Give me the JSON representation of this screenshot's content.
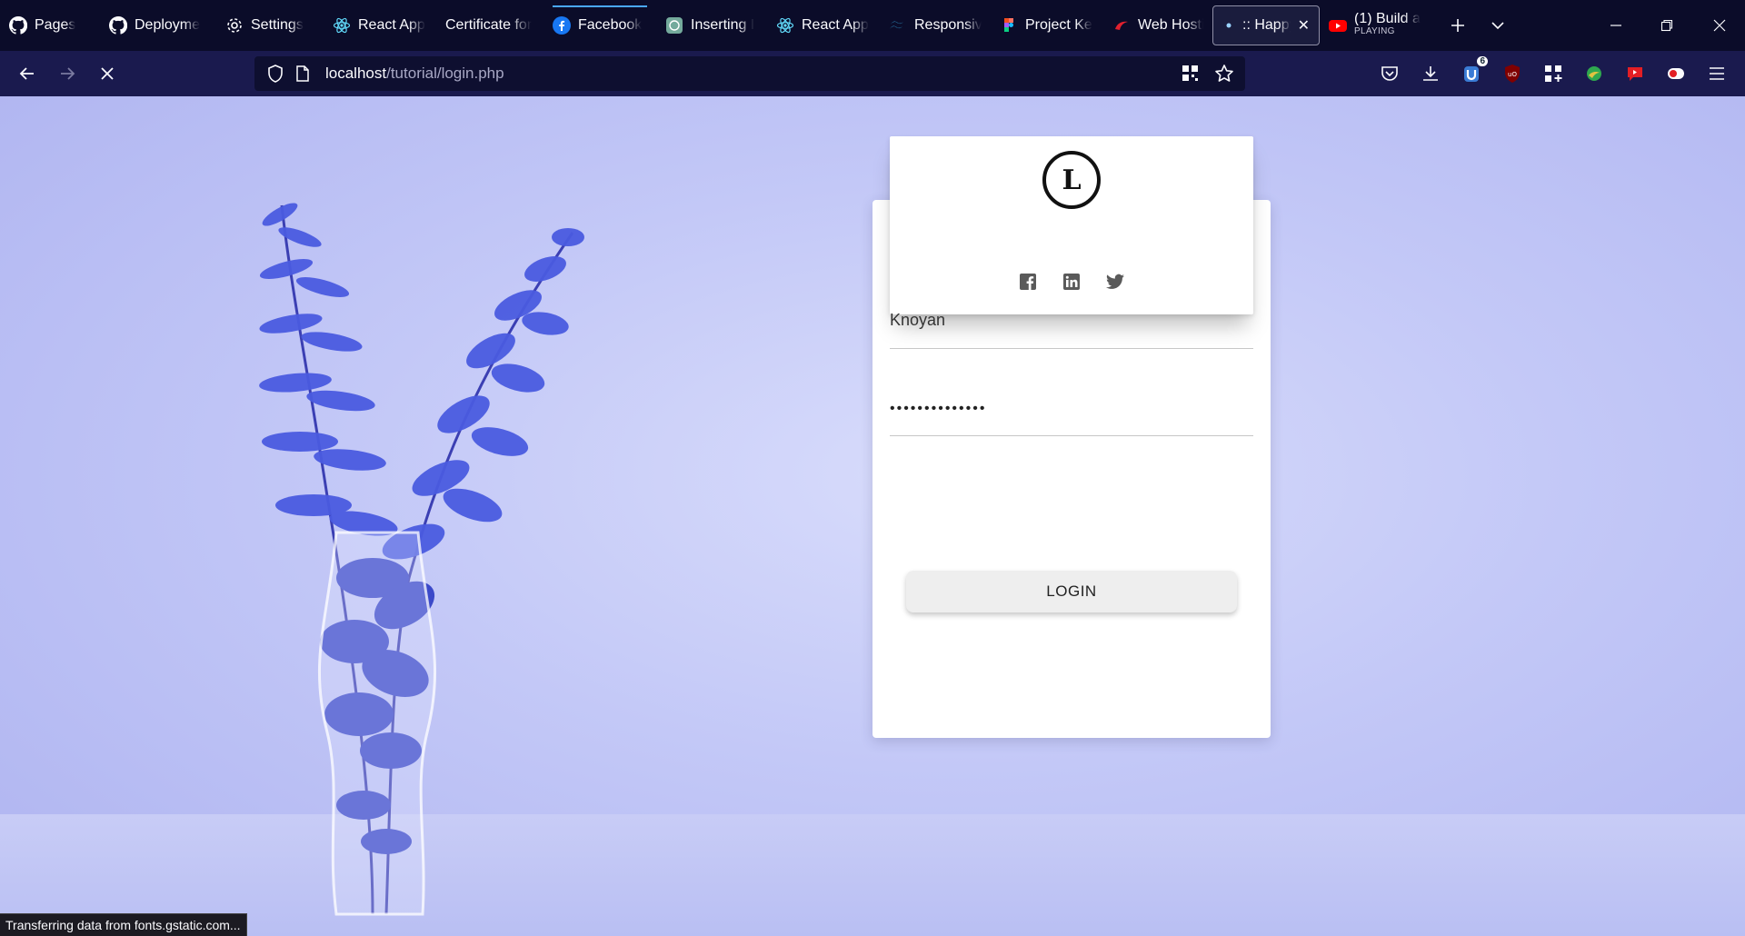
{
  "tabs": [
    {
      "title": "Pages",
      "icon": "github-icon"
    },
    {
      "title": "Deployme",
      "icon": "github-icon"
    },
    {
      "title": "Settings",
      "icon": "gear-icon"
    },
    {
      "title": "React App",
      "icon": "react-icon"
    },
    {
      "title": "Certificate for",
      "icon": "none"
    },
    {
      "title": "Facebook",
      "icon": "facebook-icon"
    },
    {
      "title": "Inserting I",
      "icon": "chatgpt-icon"
    },
    {
      "title": "React App",
      "icon": "react-icon"
    },
    {
      "title": "Responsiv",
      "icon": "tailwind-icon"
    },
    {
      "title": "Project Ke",
      "icon": "figma-icon"
    },
    {
      "title": "Web Hosti",
      "icon": "hosting-icon"
    },
    {
      "title": ":: Happy",
      "icon": "loading-dot-icon",
      "active": true
    },
    {
      "title": "(1) Build a",
      "subtitle": "PLAYING",
      "icon": "youtube-icon"
    }
  ],
  "nav": {
    "url_host": "localhost",
    "url_path": "/tutorial/login.php",
    "extension_badge": "6"
  },
  "login": {
    "logo_letter": "L",
    "username_value": "Knoyan",
    "password_mask": "••••••••••••••",
    "button_label": "LOGIN"
  },
  "status_text": "Transferring data from fonts.gstatic.com..."
}
